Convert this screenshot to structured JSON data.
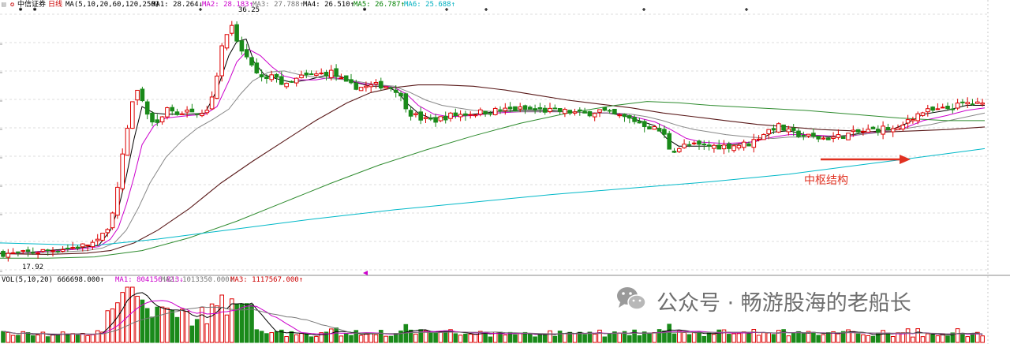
{
  "header": {
    "stock_name": "中信证券",
    "period": "日线",
    "ma_params": "MA(5,10,20,60,120,250)",
    "ma_values": [
      {
        "label": "MA1: 28.264↓",
        "color": "#000000"
      },
      {
        "label": "MA2: 28.183↑",
        "color": "#cc00cc"
      },
      {
        "label": "MA3: 27.788↑",
        "color": "#777777"
      },
      {
        "label": "MA4: 26.510↑",
        "color": "#000000"
      },
      {
        "label": "MA5: 26.787↑",
        "color": "#008000"
      },
      {
        "label": "MA6: 25.688↑",
        "color": "#00b0c0"
      }
    ]
  },
  "volume_header": {
    "params": "VOL(5,10,20) 666698.000↑",
    "ma_values": [
      {
        "label": "MA1: 804156.813↓",
        "color": "#cc00cc"
      },
      {
        "label": "MA2: 1013350.000↓",
        "color": "#777777"
      },
      {
        "label": "MA3: 1117567.000↑",
        "color": "#cc0000"
      }
    ]
  },
  "annotations": {
    "high_label": "36.25",
    "low_label": "17.92",
    "zone_label": "中枢结构"
  },
  "watermark": {
    "text": "公众号 · 畅游股海的老船长",
    "icon": "wechat-icon"
  },
  "colors": {
    "up": "#dd0000",
    "down": "#1a8a1a",
    "ma5": "#000000",
    "ma10": "#cc00cc",
    "ma20": "#888888",
    "ma60": "#5a1a1a",
    "ma120": "#2e8b2e",
    "ma250": "#00b8c8",
    "arrow": "#e03020"
  },
  "chart_data": {
    "type": "candlestick",
    "y_axis": {
      "min": 16.5,
      "max": 37
    },
    "price_path": [
      [
        0,
        18.0
      ],
      [
        20,
        17.92
      ],
      [
        60,
        18.2
      ],
      [
        100,
        18.5
      ],
      [
        125,
        18.9
      ],
      [
        140,
        20.5
      ],
      [
        150,
        23.5
      ],
      [
        160,
        27.5
      ],
      [
        172,
        31.0
      ],
      [
        182,
        29.5
      ],
      [
        195,
        28.0
      ],
      [
        210,
        29.2
      ],
      [
        240,
        29.0
      ],
      [
        262,
        29.2
      ],
      [
        272,
        31.0
      ],
      [
        280,
        34.0
      ],
      [
        292,
        36.0
      ],
      [
        300,
        34.5
      ],
      [
        310,
        33.5
      ],
      [
        322,
        32.2
      ],
      [
        335,
        31.5
      ],
      [
        350,
        32.0
      ],
      [
        360,
        31.0
      ],
      [
        380,
        31.8
      ],
      [
        400,
        32.0
      ],
      [
        420,
        32.2
      ],
      [
        440,
        31.2
      ],
      [
        460,
        31.0
      ],
      [
        480,
        31.2
      ],
      [
        500,
        31.0
      ],
      [
        510,
        30.0
      ],
      [
        520,
        29.0
      ],
      [
        535,
        28.5
      ],
      [
        550,
        28.4
      ],
      [
        570,
        28.8
      ],
      [
        600,
        29.0
      ],
      [
        630,
        29.2
      ],
      [
        660,
        29.3
      ],
      [
        690,
        29.2
      ],
      [
        720,
        29.1
      ],
      [
        740,
        28.9
      ],
      [
        760,
        29.2
      ],
      [
        780,
        28.8
      ],
      [
        800,
        28.5
      ],
      [
        820,
        28.0
      ],
      [
        840,
        27.5
      ],
      [
        850,
        26.0
      ],
      [
        870,
        26.5
      ],
      [
        890,
        26.4
      ],
      [
        920,
        26.4
      ],
      [
        950,
        26.6
      ],
      [
        970,
        27.5
      ],
      [
        985,
        28.0
      ],
      [
        1000,
        27.5
      ],
      [
        1020,
        27.2
      ],
      [
        1040,
        27.0
      ],
      [
        1060,
        27.1
      ],
      [
        1080,
        27.4
      ],
      [
        1100,
        27.6
      ],
      [
        1120,
        27.8
      ],
      [
        1140,
        27.6
      ],
      [
        1150,
        28.5
      ],
      [
        1170,
        29.1
      ],
      [
        1190,
        29.2
      ],
      [
        1210,
        29.5
      ],
      [
        1225,
        29.8
      ],
      [
        1248,
        29.6
      ]
    ],
    "ma_series": [
      {
        "id": "ma5",
        "values": [
          [
            0,
            18.0
          ],
          [
            20,
            17.95
          ],
          [
            60,
            18.2
          ],
          [
            100,
            18.4
          ],
          [
            125,
            18.6
          ],
          [
            140,
            19.8
          ],
          [
            150,
            21.5
          ],
          [
            160,
            24.0
          ],
          [
            170,
            27.0
          ],
          [
            180,
            29.5
          ],
          [
            195,
            29.0
          ],
          [
            210,
            28.9
          ],
          [
            240,
            28.9
          ],
          [
            260,
            29.0
          ],
          [
            275,
            30.8
          ],
          [
            290,
            33.5
          ],
          [
            300,
            34.6
          ],
          [
            312,
            34.8
          ],
          [
            322,
            33.0
          ],
          [
            335,
            32.0
          ],
          [
            350,
            31.7
          ],
          [
            370,
            31.4
          ],
          [
            390,
            31.6
          ],
          [
            410,
            31.9
          ],
          [
            430,
            31.9
          ],
          [
            450,
            31.4
          ],
          [
            470,
            31.1
          ],
          [
            490,
            31.1
          ],
          [
            505,
            30.6
          ],
          [
            515,
            29.8
          ],
          [
            530,
            29.0
          ],
          [
            545,
            28.6
          ],
          [
            570,
            28.7
          ],
          [
            600,
            28.9
          ],
          [
            630,
            29.1
          ],
          [
            660,
            29.2
          ],
          [
            690,
            29.2
          ],
          [
            720,
            29.1
          ],
          [
            750,
            29.0
          ],
          [
            770,
            29.0
          ],
          [
            790,
            28.8
          ],
          [
            810,
            28.4
          ],
          [
            830,
            28.0
          ],
          [
            845,
            27.0
          ],
          [
            860,
            26.4
          ],
          [
            880,
            26.4
          ],
          [
            900,
            26.4
          ],
          [
            930,
            26.5
          ],
          [
            960,
            26.8
          ],
          [
            980,
            27.5
          ],
          [
            1000,
            27.6
          ],
          [
            1020,
            27.3
          ],
          [
            1050,
            27.1
          ],
          [
            1080,
            27.3
          ],
          [
            1100,
            27.5
          ],
          [
            1130,
            27.7
          ],
          [
            1150,
            28.2
          ],
          [
            1170,
            28.9
          ],
          [
            1200,
            29.2
          ],
          [
            1225,
            29.6
          ],
          [
            1248,
            29.6
          ]
        ]
      },
      {
        "id": "ma10",
        "values": [
          [
            0,
            18.0
          ],
          [
            20,
            17.97
          ],
          [
            60,
            18.15
          ],
          [
            100,
            18.3
          ],
          [
            125,
            18.5
          ],
          [
            140,
            19.1
          ],
          [
            150,
            20.0
          ],
          [
            160,
            21.8
          ],
          [
            170,
            24.0
          ],
          [
            180,
            26.5
          ],
          [
            195,
            28.0
          ],
          [
            210,
            28.6
          ],
          [
            240,
            28.8
          ],
          [
            260,
            28.9
          ],
          [
            275,
            29.5
          ],
          [
            290,
            31.5
          ],
          [
            300,
            33.0
          ],
          [
            315,
            34.0
          ],
          [
            330,
            33.5
          ],
          [
            345,
            32.6
          ],
          [
            360,
            31.9
          ],
          [
            380,
            31.6
          ],
          [
            400,
            31.6
          ],
          [
            420,
            31.8
          ],
          [
            440,
            31.6
          ],
          [
            460,
            31.3
          ],
          [
            480,
            31.2
          ],
          [
            500,
            31.0
          ],
          [
            515,
            30.5
          ],
          [
            530,
            29.6
          ],
          [
            550,
            28.9
          ],
          [
            570,
            28.7
          ],
          [
            600,
            28.8
          ],
          [
            630,
            29.0
          ],
          [
            660,
            29.1
          ],
          [
            690,
            29.1
          ],
          [
            720,
            29.1
          ],
          [
            750,
            29.0
          ],
          [
            770,
            29.0
          ],
          [
            790,
            28.9
          ],
          [
            810,
            28.6
          ],
          [
            830,
            28.3
          ],
          [
            850,
            27.7
          ],
          [
            870,
            27.0
          ],
          [
            890,
            26.7
          ],
          [
            920,
            26.6
          ],
          [
            950,
            26.7
          ],
          [
            980,
            27.1
          ],
          [
            1000,
            27.3
          ],
          [
            1020,
            27.3
          ],
          [
            1050,
            27.2
          ],
          [
            1080,
            27.2
          ],
          [
            1100,
            27.4
          ],
          [
            1130,
            27.6
          ],
          [
            1150,
            27.9
          ],
          [
            1170,
            28.4
          ],
          [
            1200,
            28.8
          ],
          [
            1225,
            29.2
          ],
          [
            1248,
            29.4
          ]
        ]
      },
      {
        "id": "ma20",
        "values": [
          [
            0,
            18.0
          ],
          [
            40,
            18.0
          ],
          [
            80,
            18.1
          ],
          [
            110,
            18.2
          ],
          [
            130,
            18.4
          ],
          [
            145,
            18.8
          ],
          [
            160,
            19.8
          ],
          [
            175,
            21.5
          ],
          [
            190,
            23.5
          ],
          [
            210,
            25.5
          ],
          [
            230,
            26.8
          ],
          [
            250,
            27.8
          ],
          [
            270,
            28.5
          ],
          [
            290,
            29.3
          ],
          [
            305,
            30.5
          ],
          [
            320,
            31.5
          ],
          [
            340,
            32.2
          ],
          [
            360,
            32.3
          ],
          [
            380,
            32.0
          ],
          [
            400,
            31.8
          ],
          [
            420,
            31.7
          ],
          [
            440,
            31.6
          ],
          [
            460,
            31.4
          ],
          [
            480,
            31.2
          ],
          [
            500,
            31.1
          ],
          [
            520,
            30.6
          ],
          [
            540,
            30.0
          ],
          [
            560,
            29.6
          ],
          [
            580,
            29.4
          ],
          [
            600,
            29.2
          ],
          [
            630,
            29.1
          ],
          [
            660,
            29.1
          ],
          [
            690,
            29.1
          ],
          [
            720,
            29.1
          ],
          [
            750,
            29.0
          ],
          [
            780,
            29.0
          ],
          [
            800,
            28.9
          ],
          [
            820,
            28.7
          ],
          [
            840,
            28.4
          ],
          [
            860,
            28.0
          ],
          [
            880,
            27.7
          ],
          [
            900,
            27.5
          ],
          [
            920,
            27.3
          ],
          [
            950,
            27.1
          ],
          [
            980,
            27.0
          ],
          [
            1000,
            27.1
          ],
          [
            1030,
            27.1
          ],
          [
            1060,
            27.2
          ],
          [
            1090,
            27.3
          ],
          [
            1120,
            27.5
          ],
          [
            1150,
            27.8
          ],
          [
            1180,
            28.1
          ],
          [
            1210,
            28.5
          ],
          [
            1248,
            29.0
          ]
        ]
      },
      {
        "id": "ma60",
        "values": [
          [
            0,
            17.95
          ],
          [
            60,
            17.9
          ],
          [
            110,
            18.0
          ],
          [
            140,
            18.2
          ],
          [
            170,
            18.8
          ],
          [
            200,
            19.8
          ],
          [
            240,
            21.5
          ],
          [
            280,
            23.5
          ],
          [
            320,
            25.2
          ],
          [
            360,
            26.8
          ],
          [
            400,
            28.4
          ],
          [
            440,
            29.8
          ],
          [
            470,
            30.6
          ],
          [
            500,
            31.0
          ],
          [
            530,
            31.2
          ],
          [
            560,
            31.2
          ],
          [
            600,
            31.1
          ],
          [
            640,
            30.8
          ],
          [
            680,
            30.4
          ],
          [
            720,
            30.0
          ],
          [
            760,
            29.7
          ],
          [
            800,
            29.4
          ],
          [
            840,
            29.0
          ],
          [
            880,
            28.7
          ],
          [
            920,
            28.4
          ],
          [
            960,
            28.1
          ],
          [
            1000,
            27.9
          ],
          [
            1040,
            27.7
          ],
          [
            1080,
            27.6
          ],
          [
            1120,
            27.5
          ],
          [
            1160,
            27.6
          ],
          [
            1200,
            27.7
          ],
          [
            1248,
            27.9
          ]
        ]
      },
      {
        "id": "ma120",
        "values": [
          [
            0,
            17.6
          ],
          [
            60,
            17.6
          ],
          [
            120,
            17.7
          ],
          [
            180,
            18.2
          ],
          [
            240,
            19.2
          ],
          [
            300,
            20.5
          ],
          [
            360,
            22.0
          ],
          [
            420,
            23.5
          ],
          [
            480,
            24.9
          ],
          [
            540,
            26.1
          ],
          [
            600,
            27.2
          ],
          [
            660,
            28.2
          ],
          [
            720,
            29.0
          ],
          [
            780,
            29.6
          ],
          [
            820,
            29.9
          ],
          [
            860,
            29.8
          ],
          [
            900,
            29.6
          ],
          [
            960,
            29.4
          ],
          [
            1020,
            29.2
          ],
          [
            1080,
            28.9
          ],
          [
            1140,
            28.6
          ],
          [
            1200,
            28.4
          ],
          [
            1248,
            28.4
          ]
        ]
      },
      {
        "id": "ma250",
        "values": [
          [
            0,
            18.8
          ],
          [
            60,
            18.7
          ],
          [
            120,
            18.6
          ],
          [
            200,
            19.1
          ],
          [
            300,
            19.9
          ],
          [
            400,
            20.7
          ],
          [
            500,
            21.4
          ],
          [
            600,
            22.0
          ],
          [
            700,
            22.6
          ],
          [
            800,
            23.1
          ],
          [
            900,
            23.6
          ],
          [
            1000,
            24.2
          ],
          [
            1100,
            25.0
          ],
          [
            1200,
            25.8
          ],
          [
            1248,
            26.2
          ]
        ]
      }
    ]
  }
}
